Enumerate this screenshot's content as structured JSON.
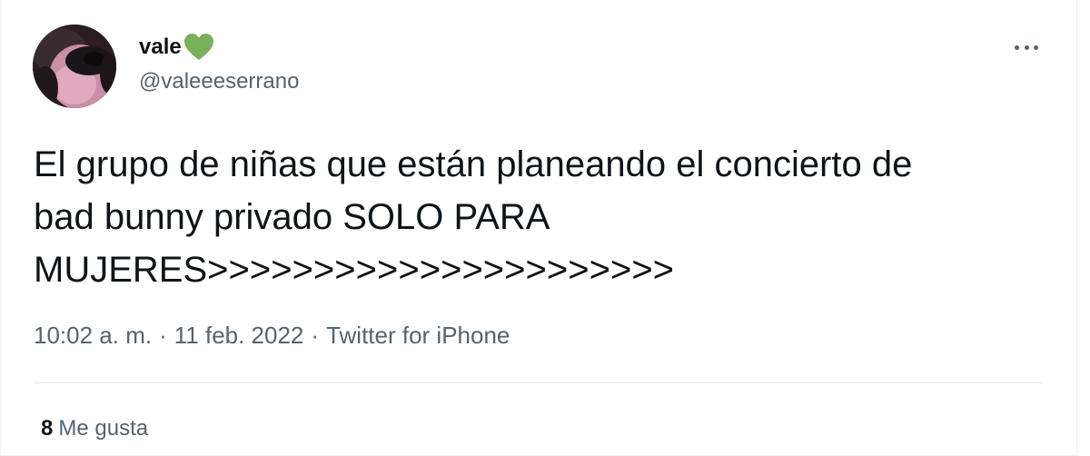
{
  "tweet": {
    "author": {
      "display_name": "vale",
      "name_emoji_icon": "green-heart-icon",
      "handle": "@valeeeserrano"
    },
    "more_icon": "more-horizontal-icon",
    "text": "El grupo de niñas que están planeando el concierto de\nbad bunny privado SOLO PARA\nMUJERES>>>>>>>>>>>>>>>>>>>>>>",
    "time": "10:02 a. m.",
    "separator": "·",
    "date": "11 feb. 2022",
    "source": "Twitter for iPhone",
    "likes": {
      "count": "8",
      "label": "Me gusta"
    }
  },
  "colors": {
    "text_primary": "#0f1419",
    "text_secondary": "#536471",
    "heart": "#78b159",
    "divider": "#e6ecf0"
  }
}
